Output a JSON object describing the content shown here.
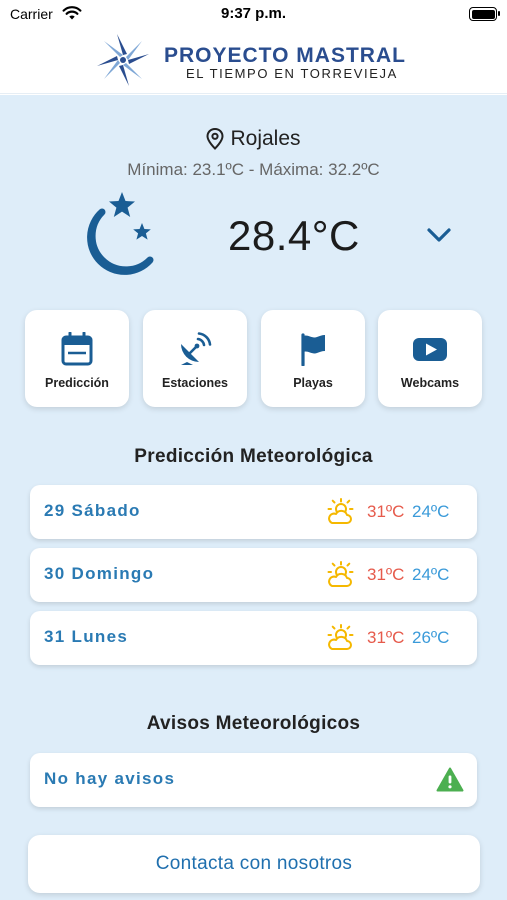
{
  "status_bar": {
    "carrier": "Carrier",
    "time": "9:37 p.m."
  },
  "header": {
    "title": "PROYECTO MASTRAL",
    "subtitle": "EL TIEMPO EN TORREVIEJA"
  },
  "current": {
    "location": "Rojales",
    "min_max": "Mínima: 23.1ºC  -  Máxima: 32.2ºC",
    "temperature": "28.4°C",
    "condition_icon": "moon-stars-icon"
  },
  "tiles": [
    {
      "label": "Predicción",
      "icon": "calendar-icon"
    },
    {
      "label": "Estaciones",
      "icon": "satellite-dish-icon"
    },
    {
      "label": "Playas",
      "icon": "flag-icon"
    },
    {
      "label": "Webcams",
      "icon": "youtube-icon"
    }
  ],
  "forecast": {
    "title": "Predicción Meteorológica",
    "days": [
      {
        "name": "29 Sábado",
        "max": "31ºC",
        "min": "24ºC",
        "icon": "sun-cloud-icon"
      },
      {
        "name": "30 Domingo",
        "max": "31ºC",
        "min": "24ºC",
        "icon": "sun-cloud-icon"
      },
      {
        "name": "31 Lunes",
        "max": "31ºC",
        "min": "26ºC",
        "icon": "sun-cloud-icon"
      }
    ]
  },
  "alerts": {
    "title": "Avisos Meteorológicos",
    "text": "No hay avisos",
    "icon": "warning-icon"
  },
  "contact": {
    "label": "Contacta con nosotros"
  },
  "colors": {
    "accent_blue": "#1f6fae",
    "day_blue": "#2a7ab3",
    "hot_red": "#e65a4b",
    "cool_blue": "#3a9ad9",
    "sun_yellow": "#f5b800",
    "warning_green": "#4caf50",
    "content_bg": "#deedf9"
  }
}
